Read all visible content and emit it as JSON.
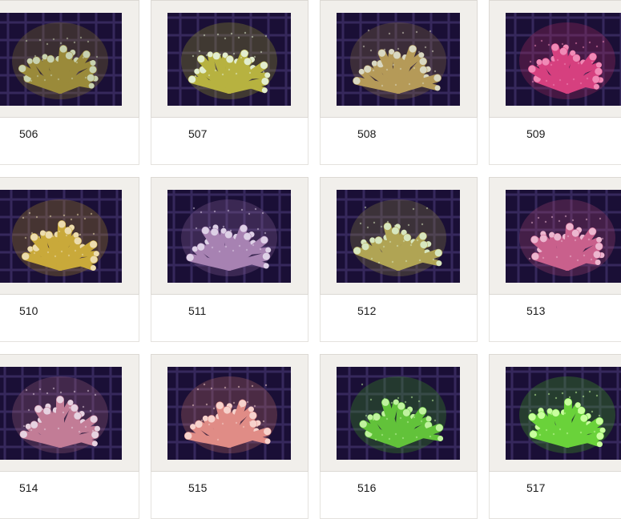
{
  "items": [
    {
      "number": "506",
      "coral": {
        "base": "#9a8a3a",
        "tip": "#c8d2b0",
        "glow": "#7a6a2a"
      }
    },
    {
      "number": "507",
      "coral": {
        "base": "#b7b240",
        "tip": "#e2edcf",
        "glow": "#8a8a2a"
      }
    },
    {
      "number": "508",
      "coral": {
        "base": "#b59a58",
        "tip": "#d9d8c2",
        "glow": "#7d6640"
      }
    },
    {
      "number": "509",
      "coral": {
        "base": "#d6407f",
        "tip": "#f08ab6",
        "glow": "#9a2a5c"
      }
    },
    {
      "number": "510",
      "coral": {
        "base": "#c9a93a",
        "tip": "#ecdcae",
        "glow": "#9a7a2a"
      }
    },
    {
      "number": "511",
      "coral": {
        "base": "#a782b2",
        "tip": "#ddd0e6",
        "glow": "#7a5a8a"
      }
    },
    {
      "number": "512",
      "coral": {
        "base": "#b0a454",
        "tip": "#d7e6bf",
        "glow": "#7e7640"
      }
    },
    {
      "number": "513",
      "coral": {
        "base": "#c9608c",
        "tip": "#ecb6cf",
        "glow": "#94406a"
      }
    },
    {
      "number": "514",
      "coral": {
        "base": "#c27c96",
        "tip": "#e6d2e0",
        "glow": "#8e5a74"
      }
    },
    {
      "number": "515",
      "coral": {
        "base": "#e08c86",
        "tip": "#f6d2cc",
        "glow": "#a8605e"
      }
    },
    {
      "number": "516",
      "coral": {
        "base": "#62c23a",
        "tip": "#bff29e",
        "glow": "#3a8a22"
      }
    },
    {
      "number": "517",
      "coral": {
        "base": "#6ad23a",
        "tip": "#c9ff9e",
        "glow": "#3f9422"
      }
    }
  ]
}
